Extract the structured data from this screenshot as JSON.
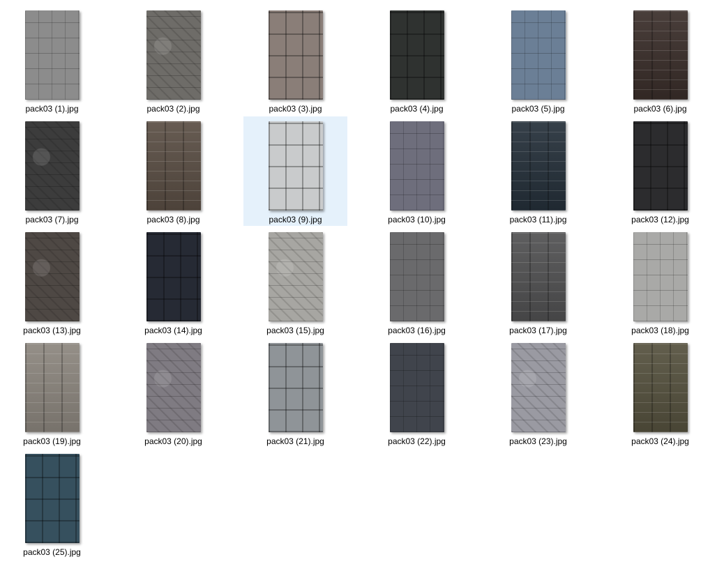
{
  "files": [
    {
      "name": "pack03 (1).jpg",
      "color": "#8c8c8c",
      "tex": "a",
      "selected": false
    },
    {
      "name": "pack03 (2).jpg",
      "color": "#6e6c68",
      "tex": "d",
      "selected": false
    },
    {
      "name": "pack03 (3).jpg",
      "color": "#8a7e78",
      "tex": "c",
      "selected": false
    },
    {
      "name": "pack03 (4).jpg",
      "color": "#2f3230",
      "tex": "c",
      "selected": false
    },
    {
      "name": "pack03 (5).jpg",
      "color": "#6b7f96",
      "tex": "a",
      "selected": false
    },
    {
      "name": "pack03 (6).jpg",
      "color": "#3a2e2a",
      "tex": "b",
      "selected": false
    },
    {
      "name": "pack03 (7).jpg",
      "color": "#3c3c3c",
      "tex": "d",
      "selected": false
    },
    {
      "name": "pack03 (8).jpg",
      "color": "#5a4e44",
      "tex": "b",
      "selected": false
    },
    {
      "name": "pack03 (9).jpg",
      "color": "#c9cbcc",
      "tex": "c",
      "selected": true
    },
    {
      "name": "pack03 (10).jpg",
      "color": "#6e6e7c",
      "tex": "a",
      "selected": false
    },
    {
      "name": "pack03 (11).jpg",
      "color": "#25303a",
      "tex": "b",
      "selected": false
    },
    {
      "name": "pack03 (12).jpg",
      "color": "#2c2c2e",
      "tex": "c",
      "selected": false
    },
    {
      "name": "pack03 (13).jpg",
      "color": "#4e4844",
      "tex": "d",
      "selected": false
    },
    {
      "name": "pack03 (14).jpg",
      "color": "#262a34",
      "tex": "c",
      "selected": false
    },
    {
      "name": "pack03 (15).jpg",
      "color": "#a7a6a2",
      "tex": "d",
      "selected": false
    },
    {
      "name": "pack03 (16).jpg",
      "color": "#6a6a6c",
      "tex": "a",
      "selected": false
    },
    {
      "name": "pack03 (17).jpg",
      "color": "#515152",
      "tex": "b",
      "selected": false
    },
    {
      "name": "pack03 (18).jpg",
      "color": "#a9a9a7",
      "tex": "a",
      "selected": false
    },
    {
      "name": "pack03 (19).jpg",
      "color": "#8c867e",
      "tex": "b",
      "selected": false
    },
    {
      "name": "pack03 (20).jpg",
      "color": "#7f7b82",
      "tex": "d",
      "selected": false
    },
    {
      "name": "pack03 (21).jpg",
      "color": "#8f9498",
      "tex": "c",
      "selected": false
    },
    {
      "name": "pack03 (22).jpg",
      "color": "#40444c",
      "tex": "a",
      "selected": false
    },
    {
      "name": "pack03 (23).jpg",
      "color": "#9a9aa2",
      "tex": "d",
      "selected": false
    },
    {
      "name": "pack03 (24).jpg",
      "color": "#55513e",
      "tex": "b",
      "selected": false
    },
    {
      "name": "pack03 (25).jpg",
      "color": "#36505e",
      "tex": "c",
      "selected": false
    }
  ]
}
